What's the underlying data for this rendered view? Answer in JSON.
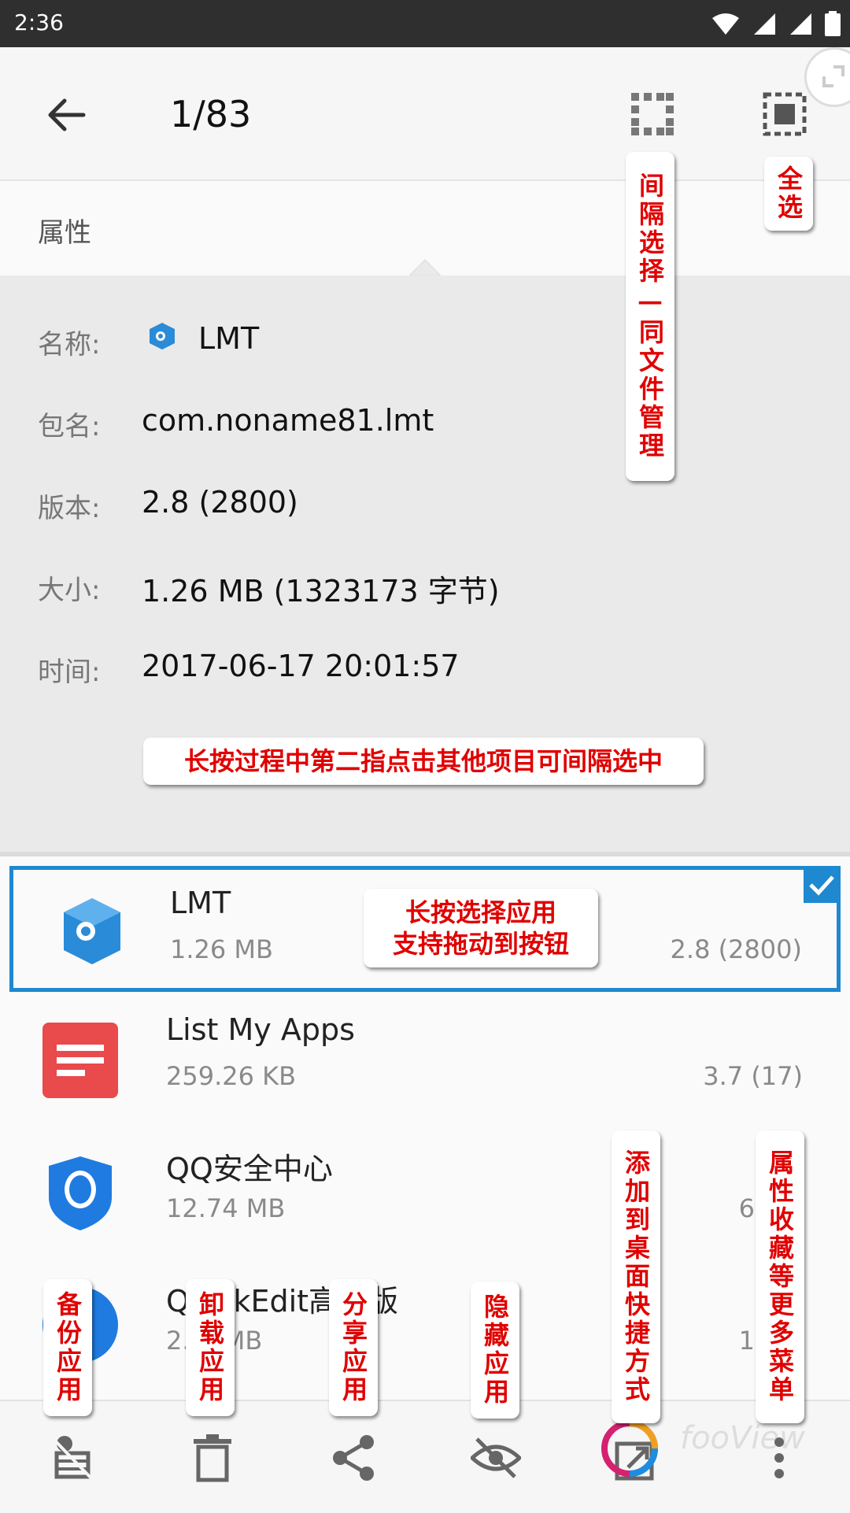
{
  "status_bar": {
    "time": "2:36"
  },
  "toolbar": {
    "title": "1/83"
  },
  "properties": {
    "header": "属性",
    "rows": [
      {
        "key": "名称:",
        "value": "LMT"
      },
      {
        "key": "包名:",
        "value": "com.noname81.lmt"
      },
      {
        "key": "版本:",
        "value": "2.8 (2800)"
      },
      {
        "key": "大小:",
        "value": "1.26 MB (1323173 字节)"
      },
      {
        "key": "时间:",
        "value": "2017-06-17 20:01:57"
      }
    ]
  },
  "apps": [
    {
      "name": "LMT",
      "size": "1.26 MB",
      "version": "2.8 (2800)",
      "selected": true
    },
    {
      "name": "List My Apps",
      "size": "259.26 KB",
      "version": "3.7 (17)"
    },
    {
      "name": "QQ安全中心",
      "size": "12.74 MB",
      "version": "6.9.6"
    },
    {
      "name": "QuickEdit高级版",
      "size": "2.__ MB",
      "version": "1.2.2"
    }
  ],
  "annotations": {
    "interval_select": "间隔选择—同文件管理",
    "select_all": "全选",
    "long_press_hint": "长按过程中第二指点击其他项目可间隔选中",
    "long_press_select_1": "长按选择应用",
    "long_press_select_2": "支持拖动到按钮",
    "add_shortcut": "添加到桌面快捷方式",
    "more_menu": "属性收藏等更多菜单",
    "backup": "备份应用",
    "uninstall": "卸载应用",
    "share": "分享应用",
    "hide": "隐藏应用"
  },
  "watermark": "fooView",
  "colors": {
    "accent": "#1e88d0",
    "annotation_text": "#e00000",
    "status_bar": "#2f2f2f"
  }
}
